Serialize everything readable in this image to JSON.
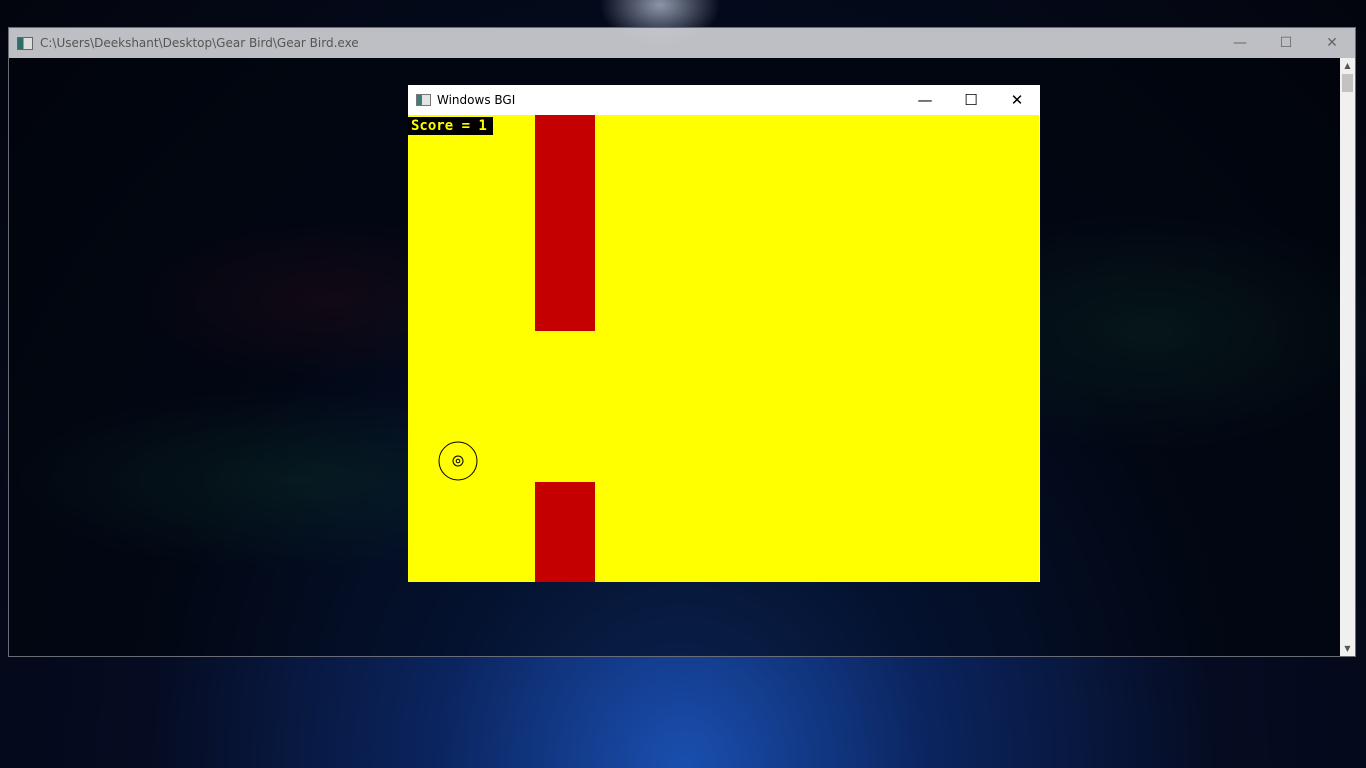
{
  "console_window": {
    "title": "C:\\Users\\Deekshant\\Desktop\\Gear Bird\\Gear Bird.exe",
    "icon": "console-app-icon",
    "controls": [
      "minimize",
      "maximize",
      "close"
    ]
  },
  "bgi_window": {
    "title": "Windows BGI",
    "icon": "bgi-app-icon",
    "controls": [
      "minimize",
      "maximize",
      "close"
    ]
  },
  "game": {
    "score_text": "Score = 1",
    "score": 1,
    "background_color": "#ffff00",
    "pipe_color": "#c40000",
    "bird": "gear-icon"
  }
}
